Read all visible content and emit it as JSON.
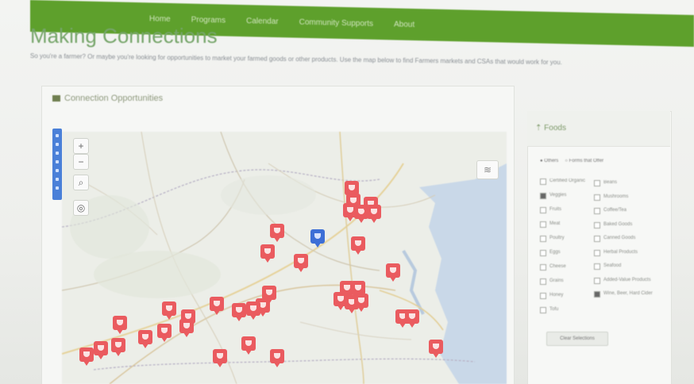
{
  "navbar": {
    "items": [
      "Home",
      "Programs",
      "Calendar",
      "Community Supports",
      "About"
    ]
  },
  "page": {
    "title": "Making Connections",
    "intro": "So you're a farmer? Or maybe you're looking for opportunities to market your farmed goods or other products. Use the map below to find Farmers markets and CSAs that would work for you."
  },
  "map_panel": {
    "heading": "Connection Opportunities",
    "controls": {
      "zoom_in": "+",
      "zoom_out": "−",
      "search": "⌕",
      "locate": "◎",
      "layers": "≋"
    },
    "markers": {
      "red_count": 45,
      "blue_count": 1
    }
  },
  "filters": {
    "title": "Foods",
    "radio": {
      "option_a": "Others",
      "option_b": "Forms that Offer"
    },
    "left_options": [
      {
        "label": "Certified Organic",
        "checked": false
      },
      {
        "label": "Veggies",
        "checked": true
      },
      {
        "label": "Fruits",
        "checked": false
      },
      {
        "label": "Meat",
        "checked": false
      },
      {
        "label": "Poultry",
        "checked": false
      },
      {
        "label": "Eggs",
        "checked": false
      },
      {
        "label": "Cheese",
        "checked": false
      },
      {
        "label": "Grains",
        "checked": false
      },
      {
        "label": "Honey",
        "checked": false
      },
      {
        "label": "Tofu",
        "checked": false
      }
    ],
    "right_options": [
      {
        "label": "Beans",
        "checked": false
      },
      {
        "label": "Mushrooms",
        "checked": false
      },
      {
        "label": "Coffee/Tea",
        "checked": false
      },
      {
        "label": "Baked Goods",
        "checked": false
      },
      {
        "label": "Canned Goods",
        "checked": false
      },
      {
        "label": "Herbal Products",
        "checked": false
      },
      {
        "label": "Seafood",
        "checked": false
      },
      {
        "label": "Added-Value Products",
        "checked": false
      },
      {
        "label": "Wine, Beer, Hard Cider",
        "checked": true
      }
    ],
    "clear_label": "Clear Selections"
  },
  "colors": {
    "nav_green": "#5ea02c",
    "marker_red": "#ea5b5f",
    "marker_blue": "#3d6fd6"
  }
}
